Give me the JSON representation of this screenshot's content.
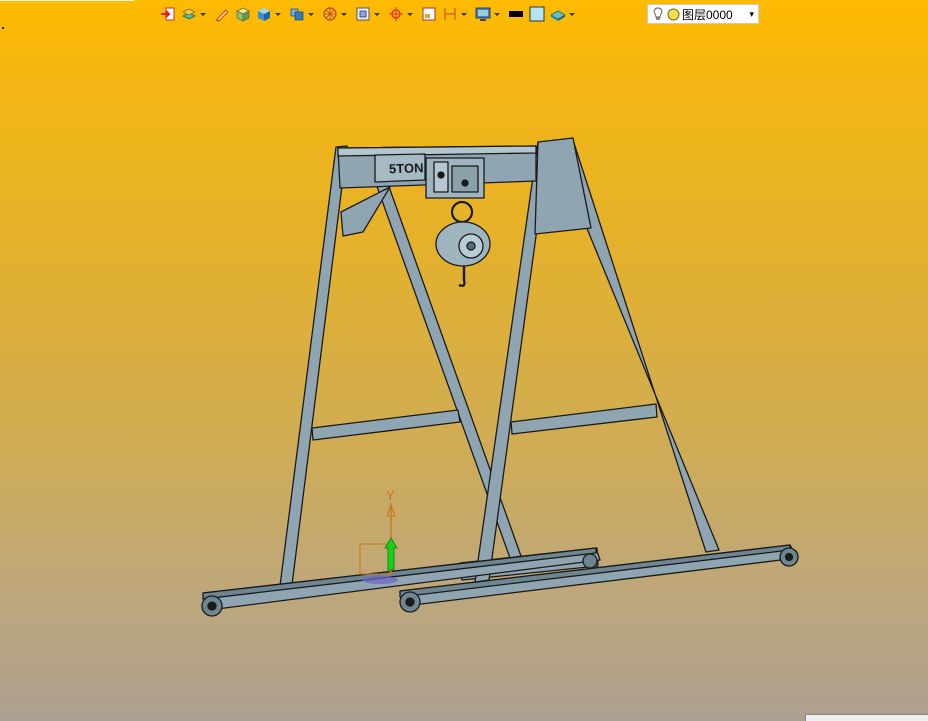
{
  "toolbar": {
    "icons": [
      "import-icon",
      "layers-tool-icon",
      "pencil-icon",
      "box-icon",
      "solid-icon",
      "view-cube-icon",
      "shading-icon",
      "snap-icon",
      "zoom-icon",
      "target-icon",
      "frame-icon",
      "dimension-icon",
      "display-icon",
      "line-color-icon",
      "fill-color-icon",
      "material-icon"
    ]
  },
  "layer_selector": {
    "value": "图层0000"
  },
  "model": {
    "beam_label": "5TON"
  },
  "axis": {
    "y_label": "Y"
  },
  "colors": {
    "steel": "#8fa6b2",
    "steel_dark": "#6e8592",
    "outline": "#1a1a1a",
    "axis_orange": "#c8741a",
    "axis_green": "#19d11a"
  }
}
